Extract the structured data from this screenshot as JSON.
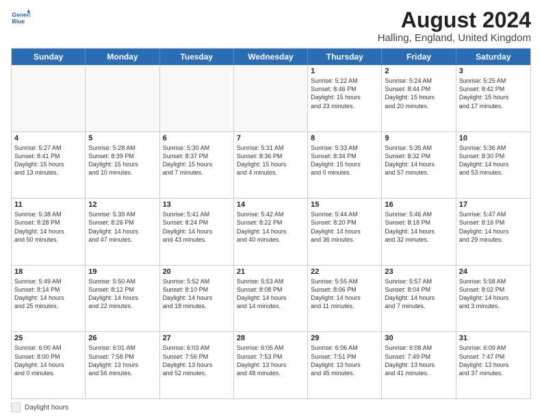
{
  "logo": {
    "line1": "General",
    "line2": "Blue"
  },
  "title": "August 2024",
  "location": "Halling, England, United Kingdom",
  "weekdays": [
    "Sunday",
    "Monday",
    "Tuesday",
    "Wednesday",
    "Thursday",
    "Friday",
    "Saturday"
  ],
  "legend": {
    "box_label": "Daylight hours"
  },
  "rows": [
    [
      {
        "day": "",
        "info": "",
        "empty": true
      },
      {
        "day": "",
        "info": "",
        "empty": true
      },
      {
        "day": "",
        "info": "",
        "empty": true
      },
      {
        "day": "",
        "info": "",
        "empty": true
      },
      {
        "day": "1",
        "info": "Sunrise: 5:22 AM\nSunset: 8:46 PM\nDaylight: 15 hours\nand 23 minutes.",
        "empty": false
      },
      {
        "day": "2",
        "info": "Sunrise: 5:24 AM\nSunset: 8:44 PM\nDaylight: 15 hours\nand 20 minutes.",
        "empty": false
      },
      {
        "day": "3",
        "info": "Sunrise: 5:25 AM\nSunset: 8:42 PM\nDaylight: 15 hours\nand 17 minutes.",
        "empty": false
      }
    ],
    [
      {
        "day": "4",
        "info": "Sunrise: 5:27 AM\nSunset: 8:41 PM\nDaylight: 15 hours\nand 13 minutes.",
        "empty": false
      },
      {
        "day": "5",
        "info": "Sunrise: 5:28 AM\nSunset: 8:39 PM\nDaylight: 15 hours\nand 10 minutes.",
        "empty": false
      },
      {
        "day": "6",
        "info": "Sunrise: 5:30 AM\nSunset: 8:37 PM\nDaylight: 15 hours\nand 7 minutes.",
        "empty": false
      },
      {
        "day": "7",
        "info": "Sunrise: 5:31 AM\nSunset: 8:36 PM\nDaylight: 15 hours\nand 4 minutes.",
        "empty": false
      },
      {
        "day": "8",
        "info": "Sunrise: 5:33 AM\nSunset: 8:34 PM\nDaylight: 15 hours\nand 0 minutes.",
        "empty": false
      },
      {
        "day": "9",
        "info": "Sunrise: 5:35 AM\nSunset: 8:32 PM\nDaylight: 14 hours\nand 57 minutes.",
        "empty": false
      },
      {
        "day": "10",
        "info": "Sunrise: 5:36 AM\nSunset: 8:30 PM\nDaylight: 14 hours\nand 53 minutes.",
        "empty": false
      }
    ],
    [
      {
        "day": "11",
        "info": "Sunrise: 5:38 AM\nSunset: 8:28 PM\nDaylight: 14 hours\nand 50 minutes.",
        "empty": false
      },
      {
        "day": "12",
        "info": "Sunrise: 5:39 AM\nSunset: 8:26 PM\nDaylight: 14 hours\nand 47 minutes.",
        "empty": false
      },
      {
        "day": "13",
        "info": "Sunrise: 5:41 AM\nSunset: 8:24 PM\nDaylight: 14 hours\nand 43 minutes.",
        "empty": false
      },
      {
        "day": "14",
        "info": "Sunrise: 5:42 AM\nSunset: 8:22 PM\nDaylight: 14 hours\nand 40 minutes.",
        "empty": false
      },
      {
        "day": "15",
        "info": "Sunrise: 5:44 AM\nSunset: 8:20 PM\nDaylight: 14 hours\nand 36 minutes.",
        "empty": false
      },
      {
        "day": "16",
        "info": "Sunrise: 5:46 AM\nSunset: 8:18 PM\nDaylight: 14 hours\nand 32 minutes.",
        "empty": false
      },
      {
        "day": "17",
        "info": "Sunrise: 5:47 AM\nSunset: 8:16 PM\nDaylight: 14 hours\nand 29 minutes.",
        "empty": false
      }
    ],
    [
      {
        "day": "18",
        "info": "Sunrise: 5:49 AM\nSunset: 8:14 PM\nDaylight: 14 hours\nand 25 minutes.",
        "empty": false
      },
      {
        "day": "19",
        "info": "Sunrise: 5:50 AM\nSunset: 8:12 PM\nDaylight: 14 hours\nand 22 minutes.",
        "empty": false
      },
      {
        "day": "20",
        "info": "Sunrise: 5:52 AM\nSunset: 8:10 PM\nDaylight: 14 hours\nand 18 minutes.",
        "empty": false
      },
      {
        "day": "21",
        "info": "Sunrise: 5:53 AM\nSunset: 8:08 PM\nDaylight: 14 hours\nand 14 minutes.",
        "empty": false
      },
      {
        "day": "22",
        "info": "Sunrise: 5:55 AM\nSunset: 8:06 PM\nDaylight: 14 hours\nand 11 minutes.",
        "empty": false
      },
      {
        "day": "23",
        "info": "Sunrise: 5:57 AM\nSunset: 8:04 PM\nDaylight: 14 hours\nand 7 minutes.",
        "empty": false
      },
      {
        "day": "24",
        "info": "Sunrise: 5:58 AM\nSunset: 8:02 PM\nDaylight: 14 hours\nand 3 minutes.",
        "empty": false
      }
    ],
    [
      {
        "day": "25",
        "info": "Sunrise: 6:00 AM\nSunset: 8:00 PM\nDaylight: 14 hours\nand 0 minutes.",
        "empty": false
      },
      {
        "day": "26",
        "info": "Sunrise: 6:01 AM\nSunset: 7:58 PM\nDaylight: 13 hours\nand 56 minutes.",
        "empty": false
      },
      {
        "day": "27",
        "info": "Sunrise: 6:03 AM\nSunset: 7:56 PM\nDaylight: 13 hours\nand 52 minutes.",
        "empty": false
      },
      {
        "day": "28",
        "info": "Sunrise: 6:05 AM\nSunset: 7:53 PM\nDaylight: 13 hours\nand 48 minutes.",
        "empty": false
      },
      {
        "day": "29",
        "info": "Sunrise: 6:06 AM\nSunset: 7:51 PM\nDaylight: 13 hours\nand 45 minutes.",
        "empty": false
      },
      {
        "day": "30",
        "info": "Sunrise: 6:08 AM\nSunset: 7:49 PM\nDaylight: 13 hours\nand 41 minutes.",
        "empty": false
      },
      {
        "day": "31",
        "info": "Sunrise: 6:09 AM\nSunset: 7:47 PM\nDaylight: 13 hours\nand 37 minutes.",
        "empty": false
      }
    ]
  ]
}
